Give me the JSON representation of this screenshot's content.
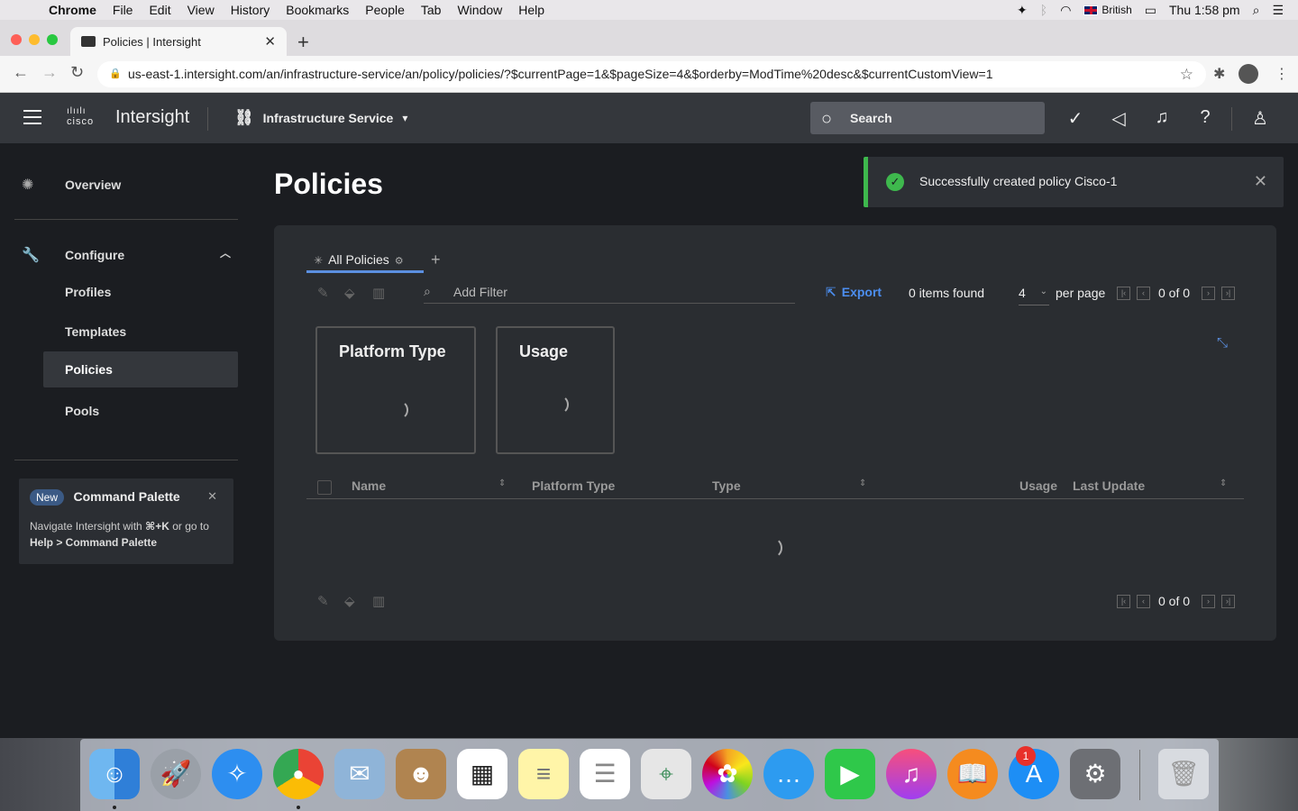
{
  "menubar": {
    "app": "Chrome",
    "items": [
      "File",
      "Edit",
      "View",
      "History",
      "Bookmarks",
      "People",
      "Tab",
      "Window",
      "Help"
    ],
    "input_source": "British",
    "clock": "Thu 1:58 pm"
  },
  "browser": {
    "tab_title": "Policies | Intersight",
    "url": "us-east-1.intersight.com/an/infrastructure-service/an/policy/policies/?$currentPage=1&$pageSize=4&$orderby=ModTime%20desc&$currentCustomView=1"
  },
  "header": {
    "cisco_text": "cisco",
    "brand": "Intersight",
    "service": "Infrastructure Service",
    "search_label": "Search"
  },
  "sidebar": {
    "overview": "Overview",
    "configure": "Configure",
    "items": [
      "Profiles",
      "Templates",
      "Policies",
      "Pools"
    ],
    "active_item": "Policies",
    "command_palette": {
      "badge": "New",
      "title": "Command Palette",
      "desc_prefix": "Navigate Intersight with",
      "shortcut": "⌘+K",
      "desc_mid": "or go to",
      "desc_path": "Help > Command Palette"
    }
  },
  "main": {
    "page_title": "Policies",
    "toast": "Successfully created policy Cisco-1",
    "tab_label": "All Policies",
    "filter_placeholder": "Add Filter",
    "export_label": "Export",
    "items_found": "0 items found",
    "page_size": "4",
    "per_page_label": "per page",
    "page_range_top": "0 of 0",
    "page_range_bottom": "0 of 0",
    "cards": [
      "Platform Type",
      "Usage"
    ],
    "columns": [
      "Name",
      "Platform Type",
      "Type",
      "Usage",
      "Last Update"
    ]
  },
  "colors": {
    "accent": "#4c8ef0",
    "success": "#3eb84d",
    "header_bg": "#34373c",
    "page_bg": "#1b1d21"
  }
}
